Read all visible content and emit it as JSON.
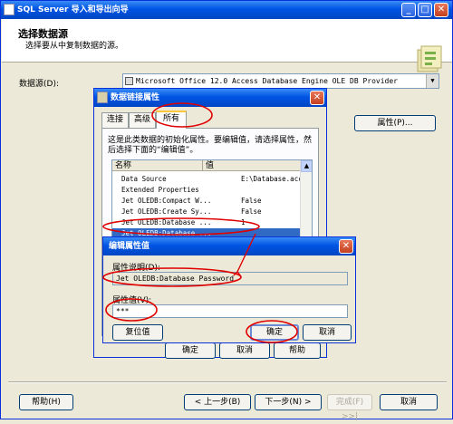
{
  "window": {
    "title": "SQL Server 导入和导出向导"
  },
  "header": {
    "title": "选择数据源",
    "subtitle": "选择要从中复制数据的源。"
  },
  "datasource": {
    "label": "数据源(D):",
    "value": "Microsoft Office 12.0 Access Database Engine OLE DB Provider"
  },
  "properties_button": "属性(P)...",
  "dialog": {
    "title": "数据链接属性",
    "tabs": [
      "连接",
      "高级",
      "所有"
    ],
    "description": "这是此类数据的初始化属性。要编辑值，请选择属性，然后选择下面的“编辑值”。",
    "columns": [
      "名称",
      "值"
    ],
    "rows": [
      {
        "name": "Data Source",
        "value": "E:\\Database.accdb"
      },
      {
        "name": "Extended Properties",
        "value": ""
      },
      {
        "name": "Jet OLEDB:Compact W...",
        "value": "False"
      },
      {
        "name": "Jet OLEDB:Create Sy...",
        "value": "False"
      },
      {
        "name": "Jet OLEDB:Database ...",
        "value": "1"
      },
      {
        "name": "Jet OLEDB:Database ...",
        "value": ""
      }
    ],
    "ok_label": "确定",
    "cancel_label": "取消",
    "help_label": "帮助"
  },
  "edit_dialog": {
    "title": "编辑属性值",
    "desc_label": "属性说明(D):",
    "desc_value": "Jet OLEDB:Database Password",
    "value_label": "属性值(V):",
    "value": "***",
    "reset_label": "复位值",
    "ok_label": "确定",
    "cancel_label": "取消"
  },
  "footer": {
    "help": "帮助(H)",
    "back": "< 上一步(B)",
    "next": "下一步(N) >",
    "finish": "完成(F) >>|",
    "cancel": "取消"
  },
  "colors": {
    "title_blue": "#0054e3",
    "xp_face": "#ece9d8",
    "selection": "#316ac5",
    "annotation_red": "#e00000"
  }
}
